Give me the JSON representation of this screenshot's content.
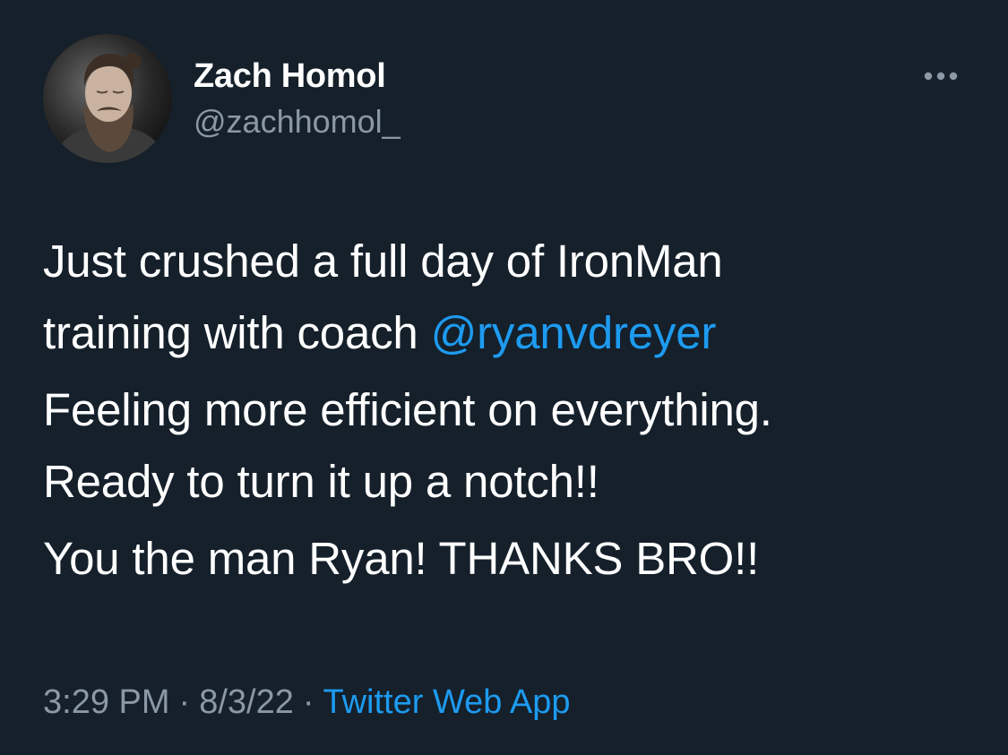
{
  "colors": {
    "background": "#15202b",
    "primary_text": "#ffffff",
    "secondary_text": "#8b98a5",
    "accent": "#1d9bf0"
  },
  "tweet": {
    "author": {
      "display_name": "Zach Homol",
      "handle": "@zachhomol_",
      "avatar_icon": "user-avatar-photo"
    },
    "more_icon": "more-horizontal-icon",
    "paragraphs": [
      {
        "line1": "Just crushed a full day of IronMan",
        "line2_prefix": "training with coach ",
        "mention": "@ryanvdreyer"
      },
      {
        "line1": "Feeling more efficient on everything.",
        "line2": "Ready to turn it up a notch!!"
      },
      {
        "line1": "You the man Ryan! THANKS BRO!!"
      }
    ],
    "meta": {
      "time": "3:29 PM",
      "separator": "·",
      "date": "8/3/22",
      "source": "Twitter Web App"
    }
  }
}
